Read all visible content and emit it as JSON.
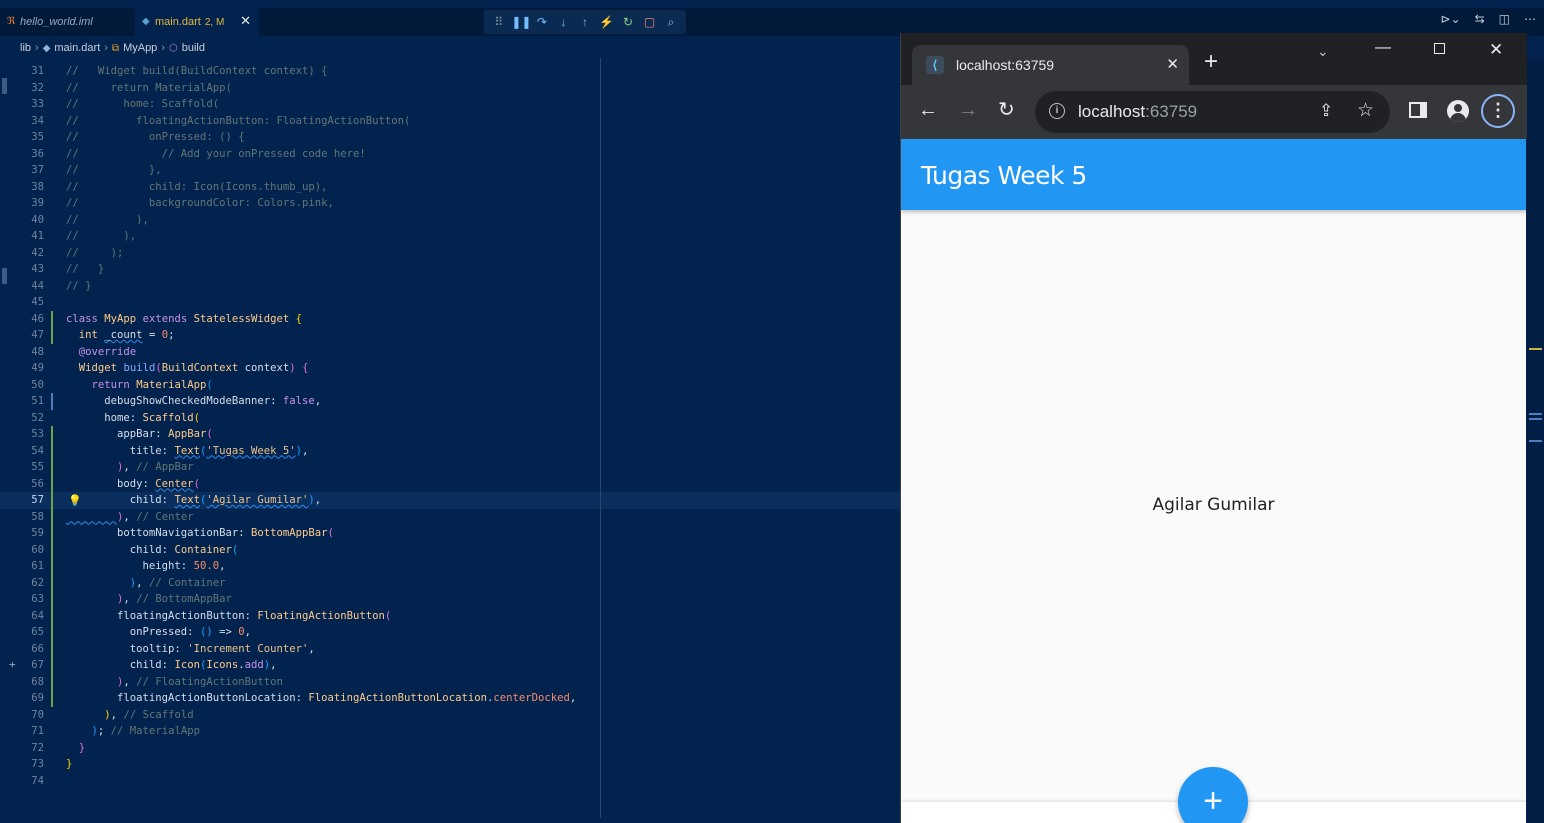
{
  "editor": {
    "tabs": [
      {
        "label": "hello_world.iml",
        "icon": "rss-icon"
      },
      {
        "label": "main.dart",
        "status": "2, M",
        "icon": "dart-icon"
      }
    ],
    "tab_close": "✕",
    "breadcrumb": [
      "lib",
      "main.dart",
      "MyApp",
      "build"
    ],
    "debug_toolbar": [
      "⠿",
      "❚❚",
      "↷",
      "↓",
      "↑",
      "⚡",
      "↻",
      "▢",
      "⌕"
    ],
    "top_actions": [
      "⊳⌄",
      "⇆",
      "◫",
      "⋯"
    ]
  },
  "browser": {
    "tab_title": "localhost:63759",
    "url_host": "localhost",
    "url_port": ":63759"
  },
  "app": {
    "appbar_title": "Tugas Week 5",
    "body_text": "Agilar Gumilar",
    "fab_icon": "+",
    "primary_color": "#2196f3"
  }
}
